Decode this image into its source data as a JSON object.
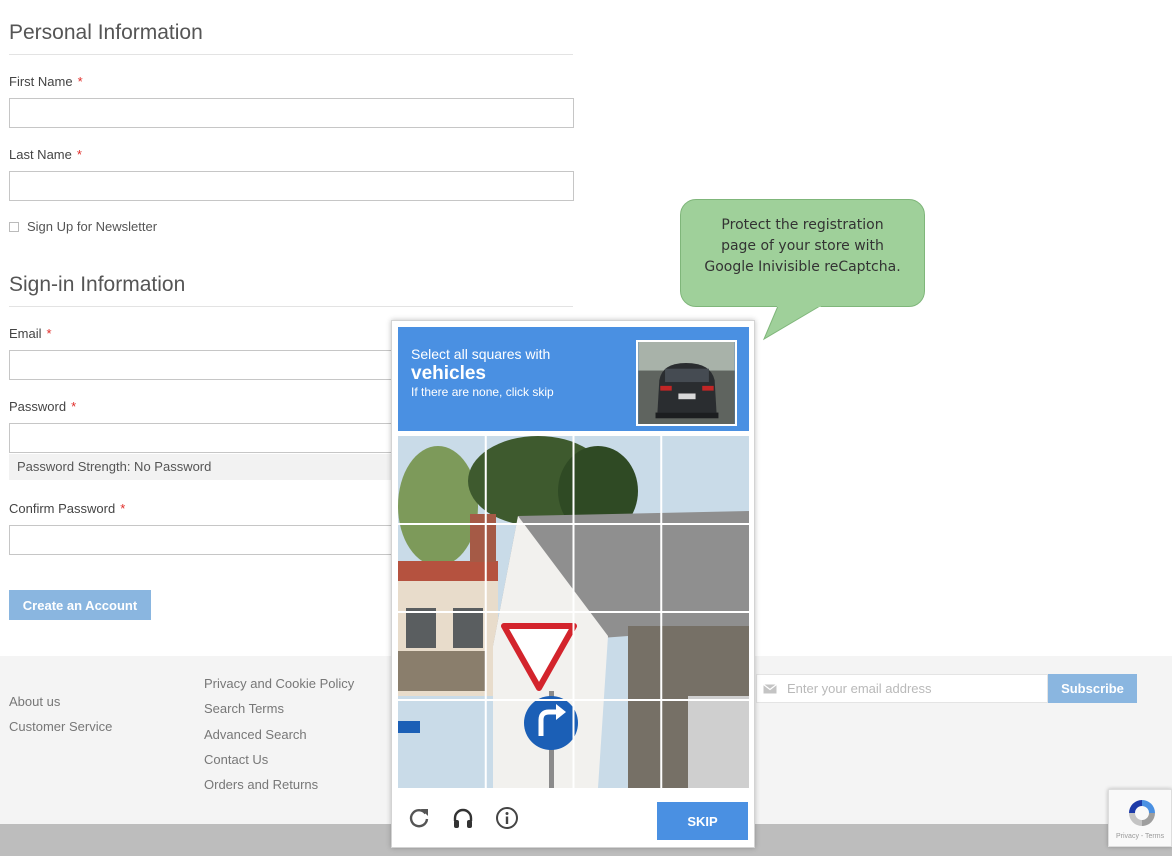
{
  "personal": {
    "title": "Personal Information",
    "first_name_label": "First Name",
    "last_name_label": "Last Name",
    "required_mark": "*",
    "newsletter_label": "Sign Up for Newsletter"
  },
  "signin": {
    "title": "Sign-in Information",
    "email_label": "Email",
    "password_label": "Password",
    "strength_text": "Password Strength: No Password",
    "confirm_label": "Confirm Password",
    "create_button": "Create an Account"
  },
  "callout": {
    "line1": "Protect the registration",
    "line2": "page of your store with",
    "line3": "Google Inivisible reCaptcha."
  },
  "captcha": {
    "line1": "Select all squares with",
    "target": "vehicles",
    "line3": "If there are none, click skip",
    "skip_button": "SKIP",
    "icons": [
      "reload-icon",
      "headphones-icon",
      "info-icon"
    ],
    "accent_color": "#4a90e2"
  },
  "footer": {
    "col1": [
      "About us",
      "Customer Service"
    ],
    "col2": [
      "Privacy and Cookie Policy",
      "Search Terms",
      "Advanced Search",
      "Contact Us",
      "Orders and Returns"
    ],
    "subscribe_placeholder": "Enter your email address",
    "subscribe_button": "Subscribe"
  },
  "recaptcha_badge": {
    "terms": "Privacy - Terms"
  },
  "colors": {
    "button": "#8ab6e0",
    "callout": "#9fd09a",
    "required": "#e02b27"
  }
}
